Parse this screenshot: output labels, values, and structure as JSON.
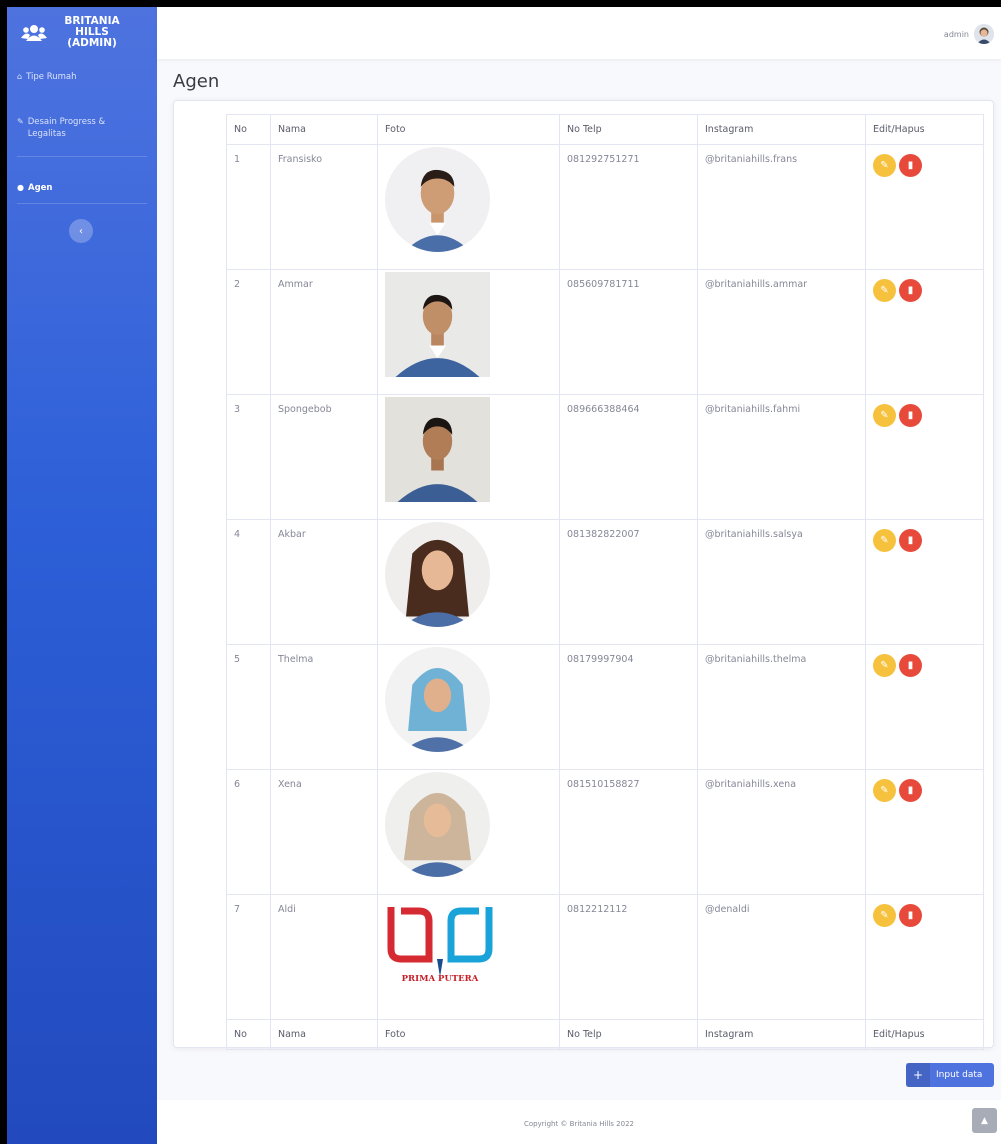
{
  "sidebar": {
    "brand": "BRITANIA HILLS (ADMIN)",
    "items": [
      {
        "label": "Tipe Rumah",
        "icon": "home-icon"
      },
      {
        "label": "Desain Progress & Legalitas",
        "icon": "pencil-icon"
      },
      {
        "label": "Agen",
        "icon": "user-icon",
        "active": true
      }
    ],
    "toggle_icon": "‹"
  },
  "topbar": {
    "user": "admin"
  },
  "page": {
    "title": "Agen"
  },
  "table": {
    "headers": [
      "No",
      "Nama",
      "Foto",
      "No Telp",
      "Instagram",
      "Edit/Hapus"
    ],
    "rows": [
      {
        "no": "1",
        "nama": "Fransisko",
        "telp": "081292751271",
        "ig": "@britaniahills.frans"
      },
      {
        "no": "2",
        "nama": "Ammar",
        "telp": "085609781711",
        "ig": "@britaniahills.ammar"
      },
      {
        "no": "3",
        "nama": "Spongebob",
        "telp": "089666388464",
        "ig": "@britaniahills.fahmi"
      },
      {
        "no": "4",
        "nama": "Akbar",
        "telp": "081382822007",
        "ig": "@britaniahills.salsya"
      },
      {
        "no": "5",
        "nama": "Thelma",
        "telp": "08179997904",
        "ig": "@britaniahills.thelma"
      },
      {
        "no": "6",
        "nama": "Xena",
        "telp": "081510158827",
        "ig": "@britaniahills.xena"
      },
      {
        "no": "7",
        "nama": "Aldi",
        "telp": "0812212112",
        "ig": "@denaldi"
      }
    ]
  },
  "logo_text": "PRIMA PUTERA",
  "actions": {
    "input_label": "Input data"
  },
  "footer": {
    "copyright": "Copyright © Britania Hills 2022"
  },
  "colors": {
    "primary": "#4e73df",
    "warning": "#f6c23e",
    "danger": "#e74a3b"
  }
}
